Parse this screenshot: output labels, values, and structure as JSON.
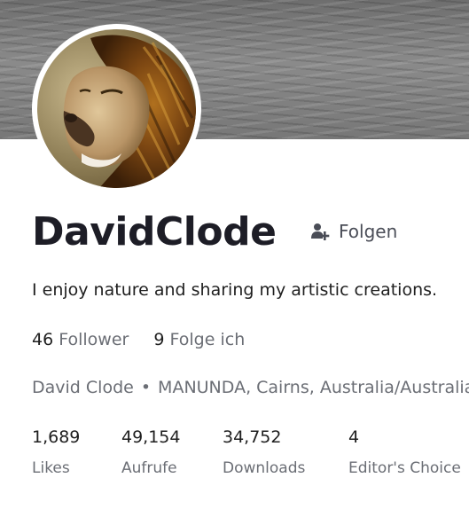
{
  "profile": {
    "username": "DavidClode",
    "follow_label": "Folgen",
    "bio": "I enjoy nature and sharing my artistic creations.",
    "follower_count": "46",
    "follower_label": "Follower",
    "following_count": "9",
    "following_label": "Folge ich",
    "full_name": "David Clode",
    "separator": "•",
    "location": "MANUNDA, Cairns, Australia/Australia"
  },
  "stats": [
    {
      "value": "1,689",
      "label": "Likes"
    },
    {
      "value": "49,154",
      "label": "Aufrufe"
    },
    {
      "value": "34,752",
      "label": "Downloads"
    },
    {
      "value": "4",
      "label": "Editor's Choice"
    }
  ],
  "icons": {
    "follow": "add-user-icon"
  },
  "colors": {
    "name": "#1d1d26",
    "muted_text": "#6b6e75",
    "follow_text": "#4a4d57"
  }
}
